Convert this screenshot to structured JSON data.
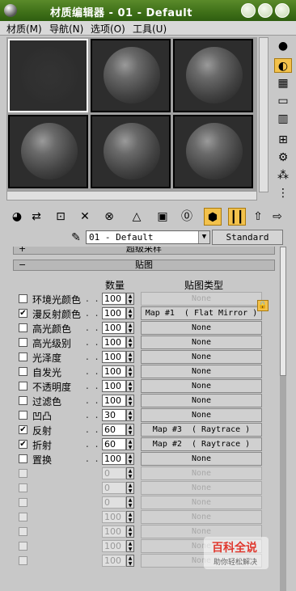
{
  "window": {
    "title": "材质编辑器 - 01 - Default"
  },
  "menu": [
    "材质(M)",
    "导航(N)",
    "选项(O)",
    "工具(U)"
  ],
  "material_picker": {
    "current": "01 - Default",
    "type_button": "Standard"
  },
  "rollouts": {
    "collapsed": "超级采样",
    "maps_title": "贴图"
  },
  "maps_header": {
    "amount": "数量",
    "map_type": "贴图类型"
  },
  "maps": [
    {
      "checked": false,
      "label": "环境光颜色",
      "amount": "100",
      "map": "None",
      "map_disabled": true
    },
    {
      "checked": true,
      "label": "漫反射颜色",
      "amount": "100",
      "map": "Map #1  ( Flat Mirror )",
      "map_disabled": false
    },
    {
      "checked": false,
      "label": "高光颜色",
      "amount": "100",
      "map": "None",
      "map_disabled": false
    },
    {
      "checked": false,
      "label": "高光级别",
      "amount": "100",
      "map": "None",
      "map_disabled": false
    },
    {
      "checked": false,
      "label": "光泽度",
      "amount": "100",
      "map": "None",
      "map_disabled": false
    },
    {
      "checked": false,
      "label": "自发光",
      "amount": "100",
      "map": "None",
      "map_disabled": false
    },
    {
      "checked": false,
      "label": "不透明度",
      "amount": "100",
      "map": "None",
      "map_disabled": false
    },
    {
      "checked": false,
      "label": "过滤色",
      "amount": "100",
      "map": "None",
      "map_disabled": false
    },
    {
      "checked": false,
      "label": "凹凸",
      "amount": "30",
      "map": "None",
      "map_disabled": false
    },
    {
      "checked": true,
      "label": "反射",
      "amount": "60",
      "map": "Map #3  ( Raytrace )",
      "map_disabled": false
    },
    {
      "checked": true,
      "label": "折射",
      "amount": "60",
      "map": "Map #2  ( Raytrace )",
      "map_disabled": false
    },
    {
      "checked": false,
      "label": "置换",
      "amount": "100",
      "map": "None",
      "map_disabled": false
    },
    {
      "checked": false,
      "label": "",
      "amount": "0",
      "map": "None",
      "map_disabled": true
    },
    {
      "checked": false,
      "label": "",
      "amount": "0",
      "map": "None",
      "map_disabled": true
    },
    {
      "checked": false,
      "label": "",
      "amount": "0",
      "map": "None",
      "map_disabled": true
    },
    {
      "checked": false,
      "label": "",
      "amount": "100",
      "map": "None",
      "map_disabled": true
    },
    {
      "checked": false,
      "label": "",
      "amount": "100",
      "map": "None",
      "map_disabled": true
    },
    {
      "checked": false,
      "label": "",
      "amount": "100",
      "map": "None",
      "map_disabled": true
    },
    {
      "checked": false,
      "label": "",
      "amount": "100",
      "map": "None",
      "map_disabled": true
    }
  ],
  "watermark": {
    "title": "百科全说",
    "subtitle": "助你轻松解决"
  }
}
